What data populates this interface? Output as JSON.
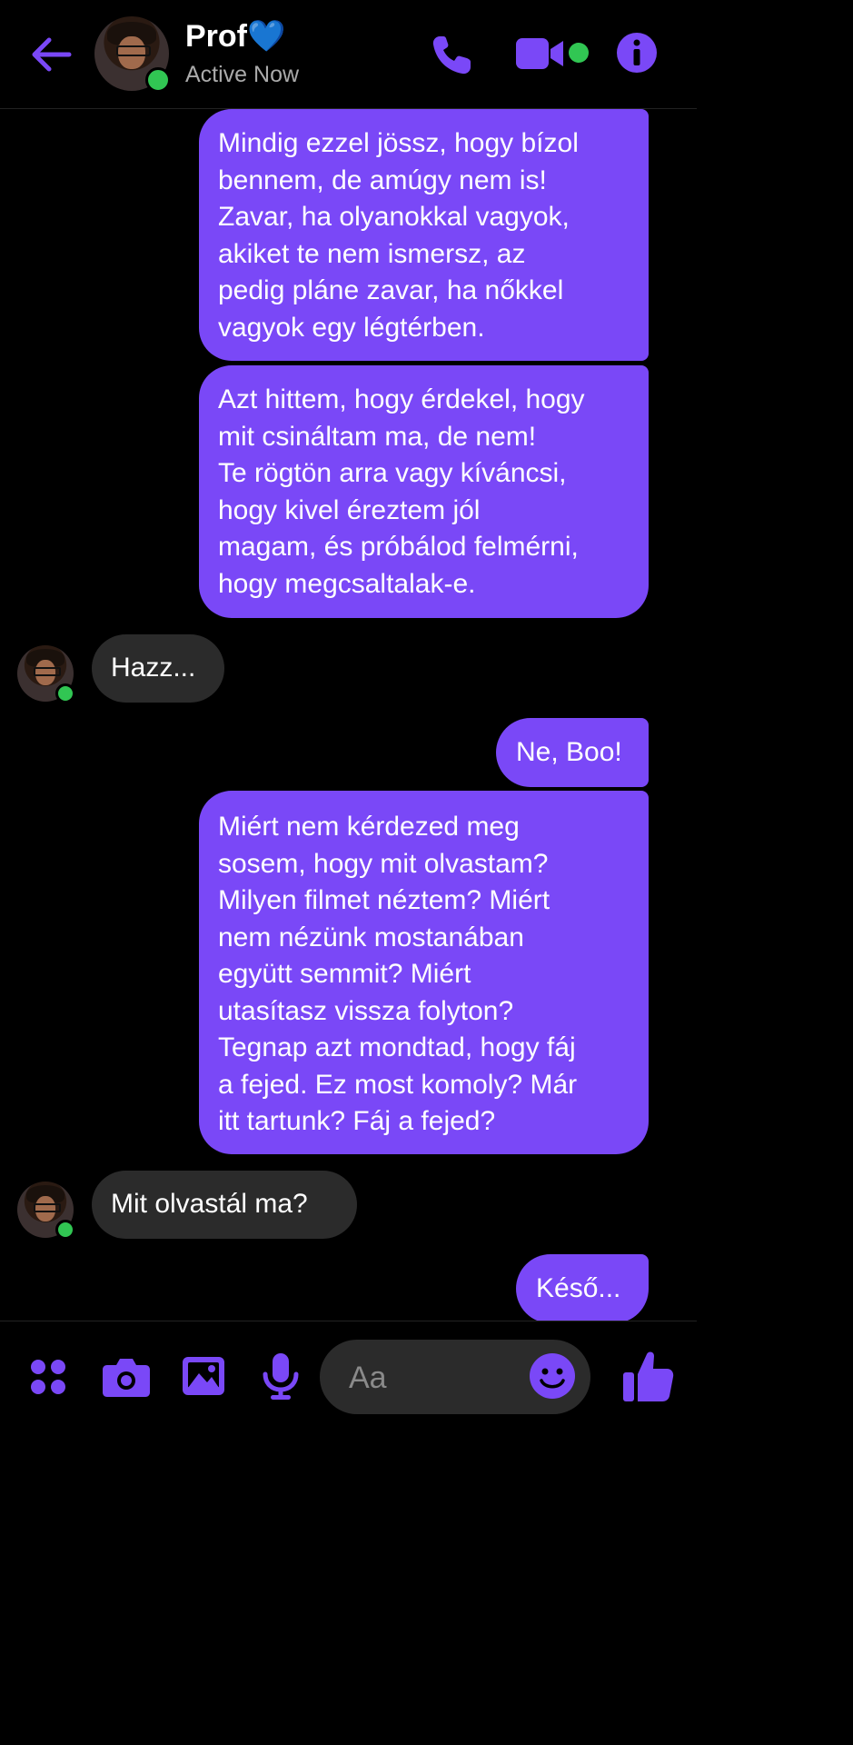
{
  "header": {
    "contact_name": "Prof💙",
    "status": "Active Now",
    "icons": [
      "back-arrow-icon",
      "phone-icon",
      "video-camera-icon",
      "info-icon"
    ]
  },
  "messages": [
    {
      "sender": "me",
      "text": "Mindig ezzel jössz, hogy bízol\nbennem, de amúgy nem is!\nZavar, ha olyanokkal vagyok,\nakiket te nem ismersz, az\npedig pláne zavar, ha nőkkel\nvagyok egy légtérben."
    },
    {
      "sender": "me",
      "text": "Azt hittem, hogy érdekel, hogy\nmit csináltam ma, de nem!\nTe rögtön arra vagy kíváncsi,\nhogy kivel éreztem jól\nmagam, és próbálod felmérni,\nhogy megcsaltalak-e."
    },
    {
      "sender": "them",
      "text": "Hazz..."
    },
    {
      "sender": "me",
      "text": "Ne, Boo!"
    },
    {
      "sender": "me",
      "text": "Miért nem kérdezed meg\nsosem, hogy mit olvastam?\nMilyen filmet néztem? Miért\nnem nézünk mostanában\negyütt semmit? Miért\nutasítasz vissza folyton?\nTegnap azt mondtad, hogy fáj\na fejed. Ez most komoly? Már\nitt tartunk? Fáj a fejed?"
    },
    {
      "sender": "them",
      "text": "Mit olvastál ma?"
    },
    {
      "sender": "me",
      "text": "Késő..."
    }
  ],
  "composer": {
    "placeholder": "Aa",
    "icons": [
      "apps-grid-icon",
      "camera-icon",
      "gallery-icon",
      "microphone-icon",
      "emoji-icon",
      "thumbs-up-icon"
    ]
  },
  "colors": {
    "accent": "#7a48f7",
    "incoming_bubble": "#2b2b2b",
    "online": "#31c653",
    "background": "#000000"
  }
}
